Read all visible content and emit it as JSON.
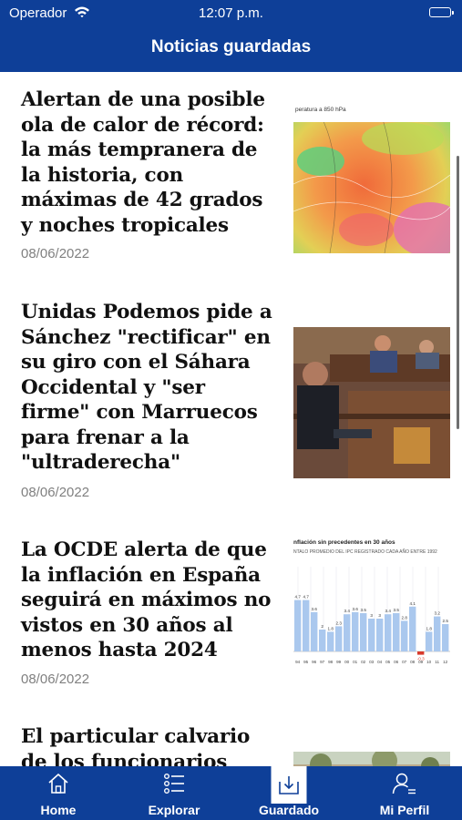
{
  "status_bar": {
    "carrier": "Operador",
    "time": "12:07 p.m."
  },
  "header": {
    "title": "Noticias guardadas"
  },
  "articles": [
    {
      "headline": "Alertan de una posible ola de calor de récord: la más tempranera de la historia, con máximas de 42 grados y noches tropicales",
      "date": "08/06/2022",
      "thumb_text": "peratura a 850 hPa"
    },
    {
      "headline": "Unidas Podemos pide a Sánchez \"rectificar\" en su giro con el Sáhara Occidental y \"ser firme\" con Marruecos para frenar a la \"ultraderecha\"",
      "date": "08/06/2022"
    },
    {
      "headline": "La OCDE alerta de que la inflación en España seguirá en máximos no vistos en 30 años al menos hasta 2024",
      "date": "08/06/2022",
      "thumb_chart": {
        "title": "nflación sin precedentes en 30 años",
        "subtitle": "NTALO PROMEDIO DEL IPC REGISTRADO CADA AÑO ENTRE 1992",
        "x": [
          "94",
          "95",
          "96",
          "97",
          "98",
          "99",
          "00",
          "01",
          "02",
          "03",
          "04",
          "05",
          "06",
          "07",
          "08",
          "09",
          "10",
          "11",
          "12"
        ],
        "values": [
          4.7,
          4.7,
          3.6,
          2.0,
          1.8,
          2.3,
          3.4,
          3.6,
          3.5,
          3.0,
          3.0,
          3.4,
          3.5,
          2.8,
          4.1,
          -0.3,
          1.8,
          3.2,
          2.5
        ],
        "labels": [
          "4.7",
          "4.7",
          "3.6",
          "2",
          "1.8",
          "2.3",
          "3.4",
          "3.6",
          "3.5",
          "3",
          "3",
          "3.4",
          "3.5",
          "2.8",
          "4.1",
          "-0.3",
          "1.8",
          "3.2",
          "2.5"
        ]
      }
    },
    {
      "headline": "El particular calvario de los funcionarios",
      "date": ""
    }
  ],
  "tabs": [
    {
      "label": "Home",
      "icon": "home-icon"
    },
    {
      "label": "Explorar",
      "icon": "list-icon"
    },
    {
      "label": "Guardado",
      "icon": "download-tray-icon",
      "active": true
    },
    {
      "label": "Mi Perfil",
      "icon": "user-icon"
    }
  ],
  "colors": {
    "brand_blue": "#0e3f98",
    "date_gray": "#808080",
    "chart_bar": "#aac8ee",
    "chart_negative": "#d93a2b"
  }
}
